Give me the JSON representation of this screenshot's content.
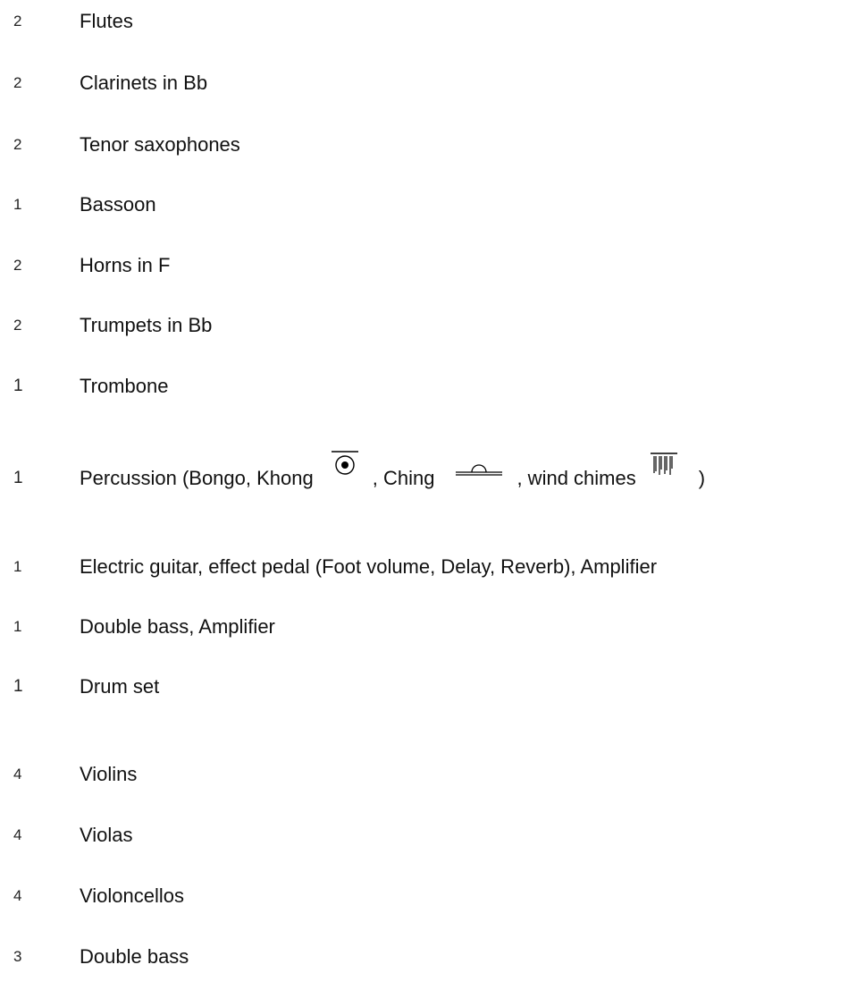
{
  "instruments": [
    {
      "qty": "2",
      "name": "Flutes"
    },
    {
      "qty": "2",
      "name": "Clarinets in Bb"
    },
    {
      "qty": "2",
      "name": "Tenor saxophones"
    },
    {
      "qty": "1",
      "name": "Bassoon"
    },
    {
      "qty": "2",
      "name": "Horns in F"
    },
    {
      "qty": "2",
      "name": "Trumpets in Bb"
    },
    {
      "qty": "1",
      "name": "Trombone"
    },
    {
      "qty": "1",
      "name_part1": "Percussion (Bongo, Khong",
      "name_part2": ",  Ching",
      "name_part3": ", wind chimes",
      "name_part4": ")",
      "icons": [
        "khong-gong-icon",
        "ching-cymbal-icon",
        "wind-chimes-icon"
      ]
    },
    {
      "qty": "1",
      "name": "Electric guitar, effect pedal (Foot volume, Delay, Reverb), Amplifier"
    },
    {
      "qty": "1",
      "name": "Double bass, Amplifier"
    },
    {
      "qty": "1",
      "name": "Drum set"
    },
    {
      "qty": "4",
      "name": "Violins"
    },
    {
      "qty": "4",
      "name": "Violas"
    },
    {
      "qty": "4",
      "name": "Violoncellos"
    },
    {
      "qty": "3",
      "name": "Double bass"
    }
  ]
}
